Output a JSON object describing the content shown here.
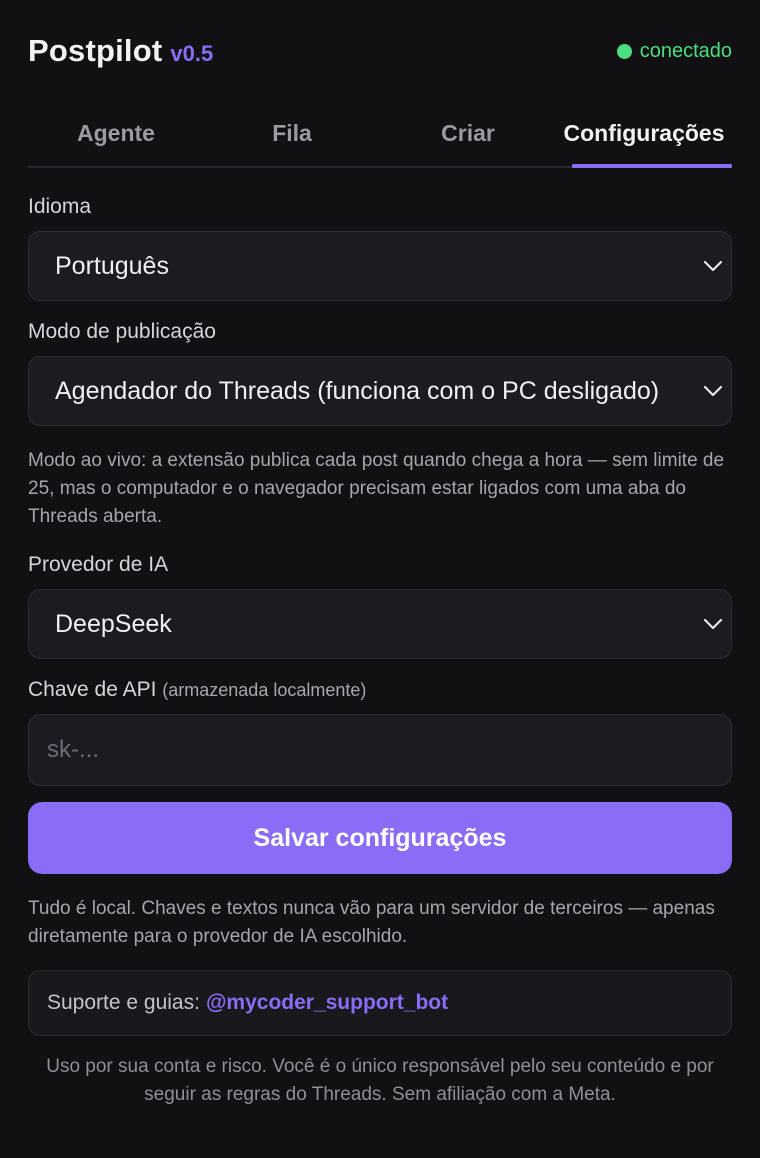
{
  "header": {
    "app_name": "Postpilot",
    "version": "v0.5",
    "status": "conectado"
  },
  "tabs": [
    {
      "label": "Agente",
      "active": false
    },
    {
      "label": "Fila",
      "active": false
    },
    {
      "label": "Criar",
      "active": false
    },
    {
      "label": "Configurações",
      "active": true
    }
  ],
  "settings": {
    "language": {
      "label": "Idioma",
      "value": "Português"
    },
    "publish_mode": {
      "label": "Modo de publicação",
      "value": "Agendador do Threads (funciona com o PC desligado)",
      "help": "Modo ao vivo: a extensão publica cada post quando chega a hora — sem limite de 25, mas o computador e o navegador precisam estar ligados com uma aba do Threads aberta."
    },
    "ai_provider": {
      "label": "Provedor de IA",
      "value": "DeepSeek"
    },
    "api_key": {
      "label": "Chave de API",
      "label_note": "(armazenada localmente)",
      "placeholder": "sk-...",
      "value": ""
    },
    "save_label": "Salvar configurações",
    "privacy_note": "Tudo é local. Chaves e textos nunca vão para um servidor de terceiros — apenas diretamente para o provedor de IA escolhido."
  },
  "support": {
    "prefix": "Suporte e guias:",
    "link": "@mycoder_support_bot"
  },
  "disclaimer": "Uso por sua conta e risco. Você é o único responsável pelo seu conteúdo e por seguir as regras do Threads. Sem afiliação com a Meta.",
  "colors": {
    "background": "#111113",
    "accent": "#8b6cf6",
    "status_ok": "#4ade80",
    "field_bg": "#1b1b21"
  },
  "icons": {
    "status": "status-dot-icon",
    "select_arrow": "chevron-down-icon"
  }
}
